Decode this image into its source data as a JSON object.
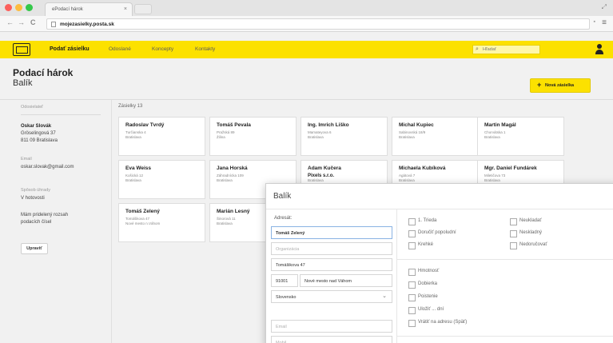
{
  "browser": {
    "tab_title": "ePodací hárok",
    "tab_close": "×",
    "url": "mojezasielky.posta.sk",
    "back": "←",
    "forward": "→",
    "reload": "C",
    "menu": "≡",
    "resize": "⤢",
    "traffic_colors": [
      "#fc605c",
      "#fdbc40",
      "#34c84a"
    ]
  },
  "header": {
    "brand": "Podať zásielku",
    "nav": [
      "Odoslané",
      "Koncepty",
      "Kontakty"
    ],
    "search_placeholder": "Hľadať",
    "accent": "#fce100"
  },
  "page": {
    "title": "Podací hárok",
    "subtitle": "Balík",
    "new_button": "Nová zásielka",
    "new_button_icon": "+"
  },
  "sender": {
    "label": "Odosielateľ",
    "name": "Oskar Slovák",
    "street": "Gröselingová 37",
    "city": "811 09 Bratislava",
    "email_label": "Email",
    "email": "oskar.slovak@gmail.com",
    "payment_label": "Spôsob úhrady",
    "payment": "V hotovosti",
    "range_line1": "Mám pridelený rozsah",
    "range_line2": "podacích čísel",
    "edit_button": "Upraviť"
  },
  "shipments": {
    "label": "Zásielky 13",
    "cards": [
      {
        "name": "Radoslav Tvrdý",
        "line1": "Turčianska 4",
        "line2": "Bratislava"
      },
      {
        "name": "Tomáš Pevala",
        "line1": "Pražská 89",
        "line2": "Žilina"
      },
      {
        "name": "Ing. Imrich Liško",
        "line1": "Mamateyova 6",
        "line2": "Bratislava"
      },
      {
        "name": "Michal Kupiec",
        "line1": "Sabinovská 18/9",
        "line2": "Bratislava"
      },
      {
        "name": "Martin Magál",
        "line1": "Chorvátska 1",
        "line2": "Bratislava"
      },
      {
        "name": "Eva Weiss",
        "line1": "Košická 12",
        "line2": "Bratislava"
      },
      {
        "name": "Jana Horská",
        "line1": "Záhradnícka 109",
        "line2": "Bratislava"
      },
      {
        "name": "Adam Kučera",
        "line1": "Pixels s.r.o.",
        "line2": "Bratislava"
      },
      {
        "name": "Michaela Kubíková",
        "line1": "Agátová 7",
        "line2": "Bratislava"
      },
      {
        "name": "Mgr. Daniel Fundárek",
        "line1": "Miletičova 73",
        "line2": "Bratislava"
      },
      {
        "name": "Tomáš Zelený",
        "line1": "Tomášikova 47",
        "line2": "Nové mesto n.Váhom"
      },
      {
        "name": "Marián Lesný",
        "line1": "Šinorová 11",
        "line2": "Bratislava"
      }
    ]
  },
  "modal": {
    "title": "Balík",
    "recipient_label": "Adresát:",
    "name_value": "Tomáš Zelený",
    "org_placeholder": "Organizácia",
    "street_value": "Tomášikova 47",
    "zip_value": "91001",
    "city_value": "Nové mesto nad Váhom",
    "country_value": "Slovensko",
    "email_placeholder": "Email",
    "mobile_placeholder": "Mobil",
    "options_left": [
      "1. Trieda",
      "Doručiť popoludní",
      "Krehké"
    ],
    "options_right": [
      "Neukladať",
      "Neskladný",
      "Nedoručovať"
    ],
    "options_extra": [
      "Hmotnosť",
      "Dobierka",
      "Poistenie",
      "Uložiť ... dní",
      "Vrátiť na adresu (Späť)"
    ]
  }
}
